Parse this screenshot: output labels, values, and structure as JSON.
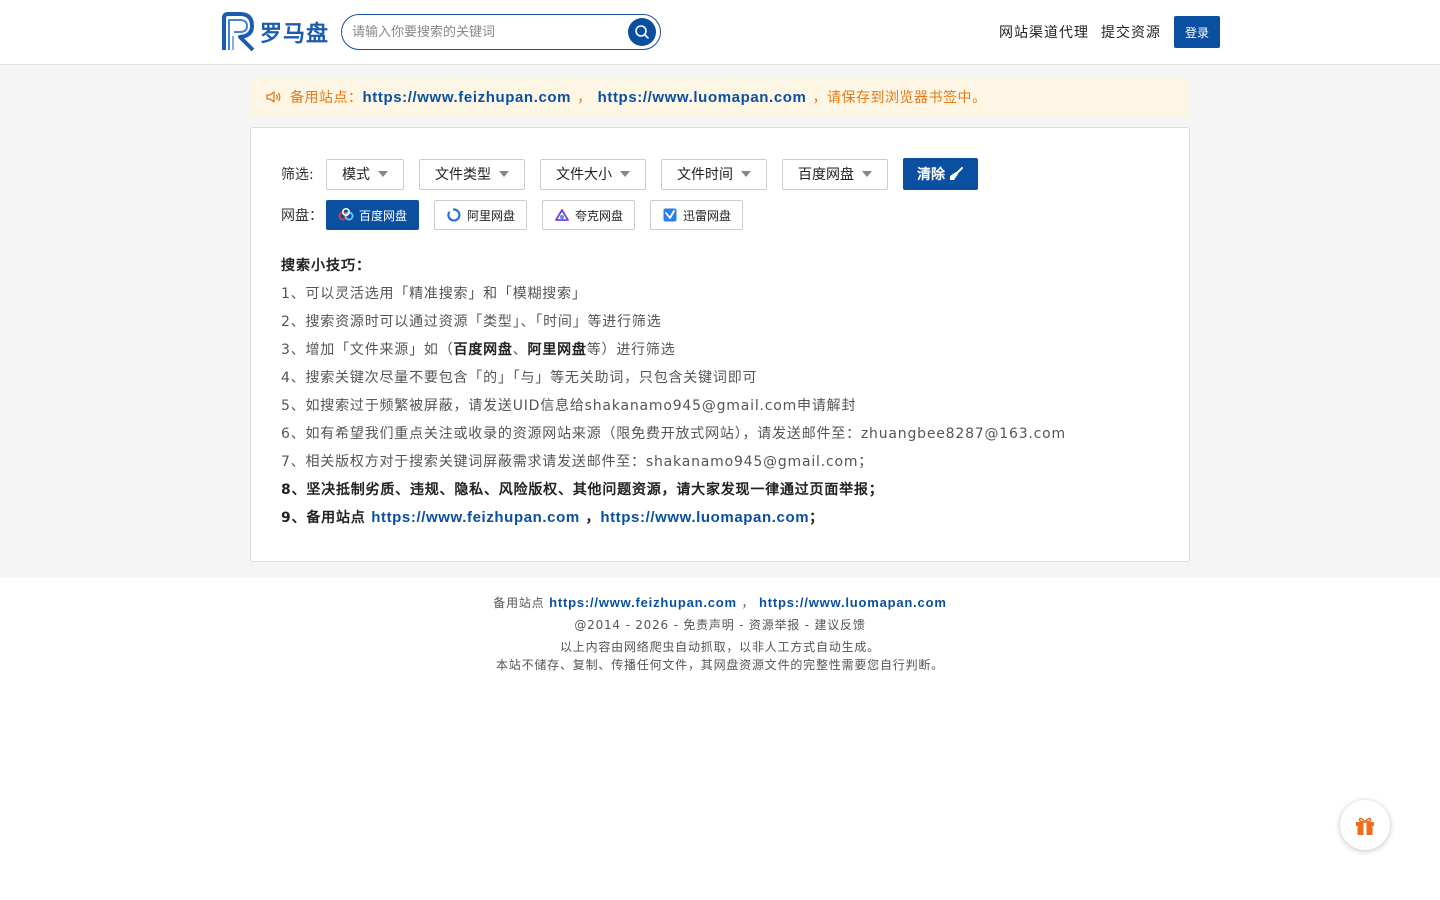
{
  "header": {
    "logo_text": "罗马盘",
    "search_placeholder": "请输入你要搜索的关键词",
    "nav": [
      "网站渠道代理",
      "提交资源"
    ],
    "login_label": "登录"
  },
  "notice": {
    "prefix": "备用站点：",
    "link1": "https://www.feizhupan.com",
    "sep": "，",
    "link2": "https://www.luomapan.com",
    "suffix": "，请保存到浏览器书签中。"
  },
  "filters": {
    "label": "筛选:",
    "dropdowns": [
      "模式",
      "文件类型",
      "文件大小",
      "文件时间",
      "百度网盘"
    ],
    "clear_label": "清除"
  },
  "disks": {
    "label": "网盘：",
    "items": [
      "百度网盘",
      "阿里网盘",
      "夸克网盘",
      "迅雷网盘"
    ],
    "active": "百度网盘"
  },
  "tips": {
    "title": "搜索小技巧：",
    "t1": "1、可以灵活选用「精准搜索」和「模糊搜索」",
    "t2": "2、搜索资源时可以通过资源「类型」、「时间」等进行筛选",
    "t3_a": "3、增加「文件来源」如（",
    "t3_b": "百度网盘",
    "t3_c": "、",
    "t3_d": "阿里网盘",
    "t3_e": "等）进行筛选",
    "t4": "4、搜索关键次尽量不要包含「的」「与」等无关助词，只包含关键词即可",
    "t5": "5、如搜索过于频繁被屏蔽，请发送UID信息给shakanamo945@gmail.com申请解封",
    "t6": "6、如有希望我们重点关注或收录的资源网站来源（限免费开放式网站），请发送邮件至：zhuangbee8287@163.com",
    "t7": "7、相关版权方对于搜索关键词屏蔽需求请发送邮件至：shakanamo945@gmail.com；",
    "t8": "8、坚决抵制劣质、违规、隐私、风险版权、其他问题资源，请大家发现一律通过页面举报；",
    "t9_prefix": "9、备用站点 ",
    "t9_link1": "https://www.feizhupan.com",
    "t9_sep": " ，",
    "t9_link2": "https://www.luomapan.com",
    "t9_suffix": "；"
  },
  "footer": {
    "backup_prefix": "备用站点 ",
    "link1": "https://www.feizhupan.com",
    "sep": " ，",
    "link2": "https://www.luomapan.com",
    "copyright": "@2014 - 2026",
    "dash": " - ",
    "disclaimer": "免责声明",
    "report": "资源举报",
    "feedback": "建议反馈",
    "note1": "以上内容由网络爬虫自动抓取，以非人工方式自动生成。",
    "note2": "本站不储存、复制、传播任何文件，其网盘资源文件的完整性需要您自行判断。"
  },
  "colors": {
    "brand": "#0b4fa0",
    "notice_bg": "#fdf6e4",
    "notice_text": "#e07a1a",
    "gift": "#f26b1d"
  }
}
